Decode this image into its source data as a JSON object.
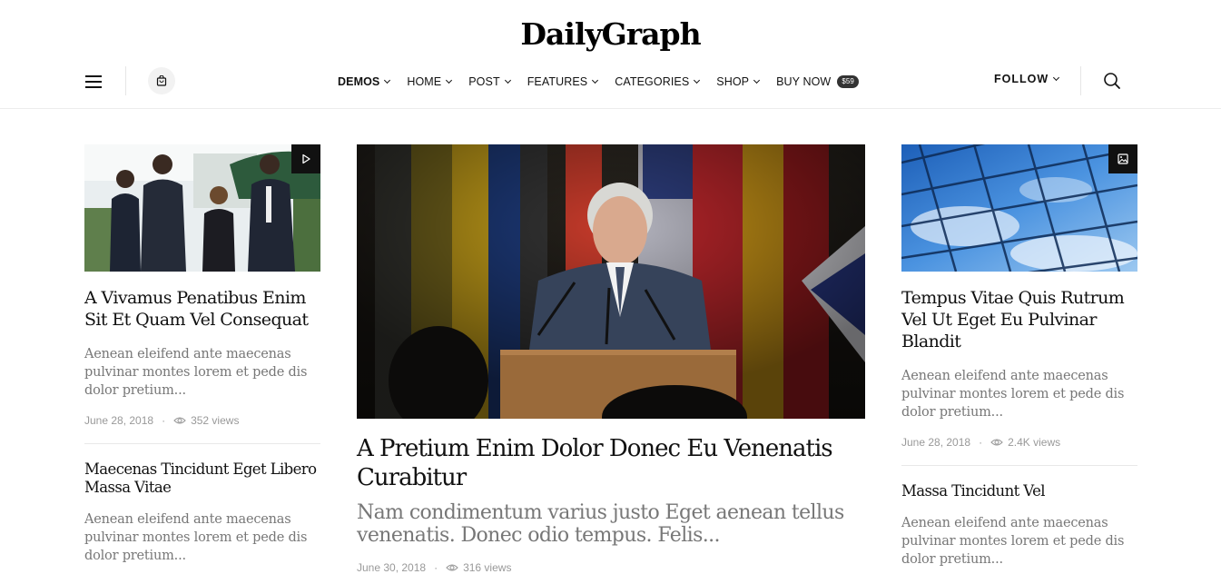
{
  "site": {
    "logo": "DailyGraph"
  },
  "nav": {
    "items": [
      {
        "label": "DEMOS"
      },
      {
        "label": "HOME"
      },
      {
        "label": "POST"
      },
      {
        "label": "FEATURES"
      },
      {
        "label": "CATEGORIES"
      },
      {
        "label": "SHOP"
      },
      {
        "label": "BUY NOW",
        "badge": "$59"
      }
    ],
    "follow_label": "FOLLOW"
  },
  "icons": {
    "menu": "hamburger-menu-icon",
    "cart": "shopping-bag-icon",
    "search": "search-icon",
    "video": "play-icon",
    "gallery": "image-icon",
    "views": "eye-icon"
  },
  "left_column": {
    "featured": {
      "title": "A Vivamus Penatibus Enim Sit Et Quam Vel Consequat",
      "excerpt": "Aenean eleifend ante maecenas pulvinar montes lorem et pede dis dolor pretium...",
      "date": "June 28, 2018",
      "views": "352 views"
    },
    "second": {
      "title": "Maecenas Tincidunt Eget Libero Massa Vitae",
      "excerpt": "Aenean eleifend ante maecenas pulvinar montes lorem et pede dis dolor pretium..."
    }
  },
  "center_column": {
    "featured": {
      "title": "A Pretium Enim Dolor Donec Eu Venenatis Curabitur",
      "excerpt": "Nam condimentum varius justo Eget aenean tellus venenatis. Donec odio tempus. Felis...",
      "date": "June 30, 2018",
      "views": "316 views"
    }
  },
  "right_column": {
    "featured": {
      "title": "Tempus Vitae Quis Rutrum Vel Ut Eget Eu Pulvinar Blandit",
      "excerpt": "Aenean eleifend ante maecenas pulvinar montes lorem et pede dis dolor pretium...",
      "date": "June 28, 2018",
      "views": "2.4K views"
    },
    "second": {
      "title": "Massa Tincidunt Vel",
      "excerpt": "Aenean eleifend ante maecenas pulvinar montes lorem et pede dis dolor pretium..."
    }
  },
  "meta_separator": "·"
}
